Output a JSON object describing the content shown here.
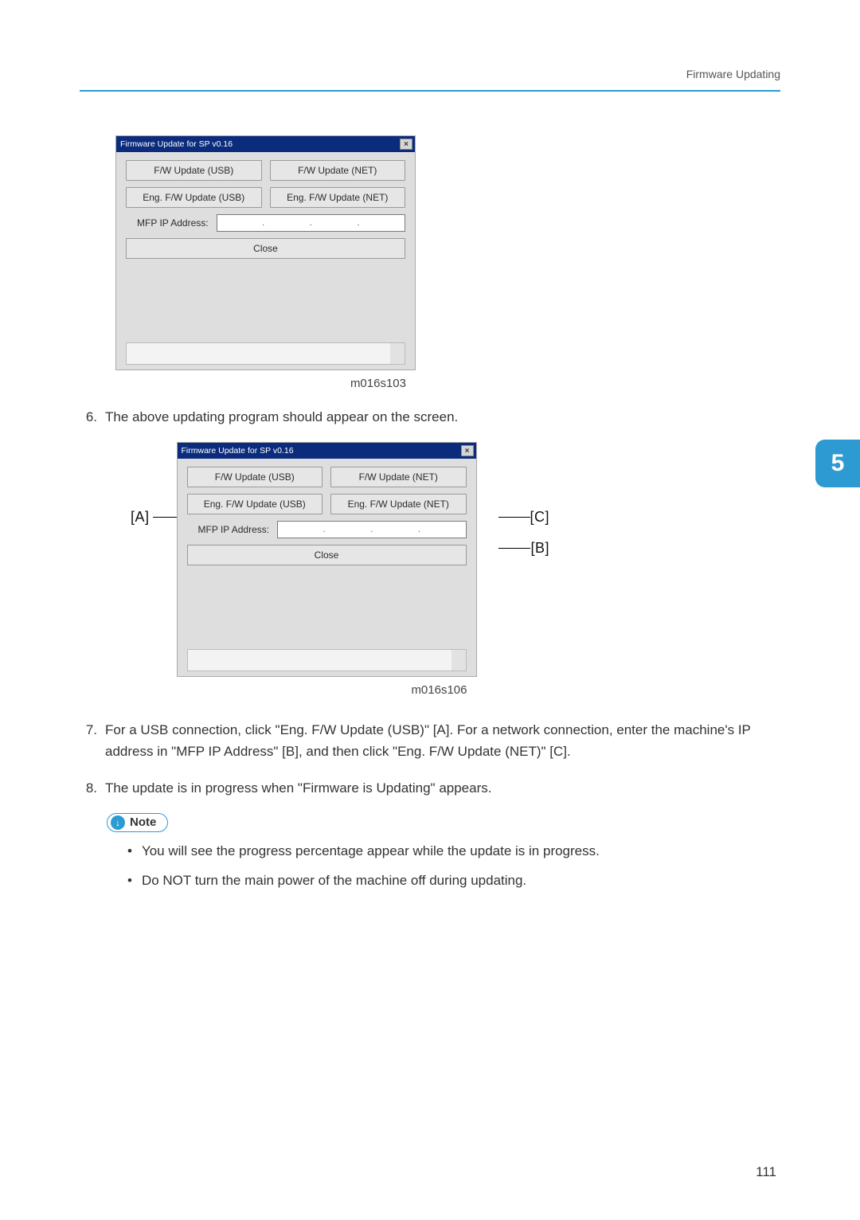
{
  "header": {
    "label": "Firmware Updating"
  },
  "side_tab": "5",
  "page_number": "111",
  "dialog": {
    "title": "Firmware Update for SP v0.16",
    "btn_fw_usb": "F/W Update (USB)",
    "btn_fw_net": "F/W Update (NET)",
    "btn_eng_usb": "Eng. F/W Update (USB)",
    "btn_eng_net": "Eng. F/W Update (NET)",
    "ip_label": "MFP IP Address:",
    "ip_dots": ".",
    "close_label": "Close",
    "close_x": "×"
  },
  "fig1": {
    "caption": "m016s103"
  },
  "fig2": {
    "caption": "m016s106",
    "callout_a": "[A]",
    "callout_b": "[B]",
    "callout_c": "[C]"
  },
  "steps": {
    "s6": {
      "num": "6.",
      "text": "The above updating program should appear on the screen."
    },
    "s7": {
      "num": "7.",
      "text": "For a USB connection, click \"Eng. F/W Update (USB)\" [A]. For a network connection, enter the machine's IP address in \"MFP IP Address\" [B], and then click \"Eng. F/W Update (NET)\" [C]."
    },
    "s8": {
      "num": "8.",
      "text": "The update is in progress when \"Firmware is Updating\" appears."
    }
  },
  "note": {
    "label": "Note",
    "items": [
      "You will see the progress percentage appear while the update is in progress.",
      "Do NOT turn the main power of the machine off during updating."
    ]
  }
}
